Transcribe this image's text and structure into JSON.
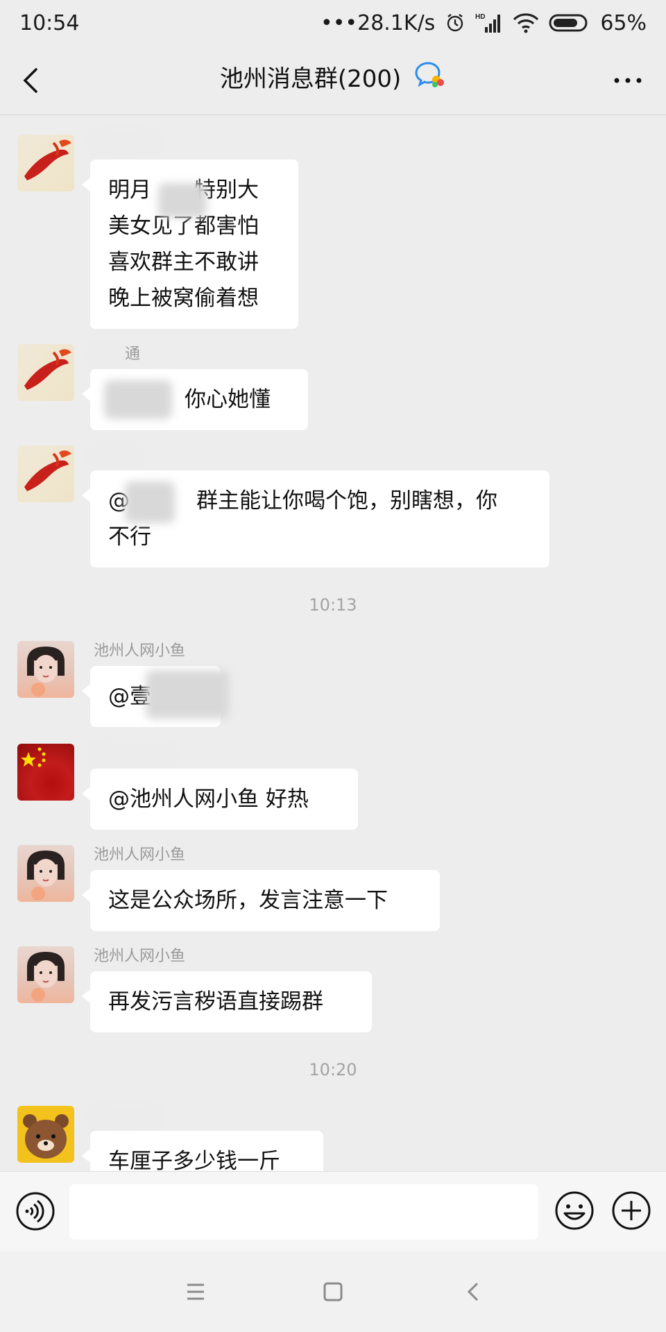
{
  "status_bar": {
    "time": "10:54",
    "network_speed": "•••28.1K/s",
    "battery": "65%",
    "hd_label": "HD"
  },
  "header": {
    "title": "池州消息群(200)"
  },
  "messages": [
    {
      "sender": "",
      "text": "明月  特别大\n美女见了都害怕\n喜欢群主不敢讲\n晚上被窝偷着想",
      "avatar": "koi-avatar"
    },
    {
      "sender": "通",
      "text": "旦  你心她懂",
      "avatar": "koi-avatar"
    },
    {
      "sender": "",
      "text": "@  群主能让你喝个饱，别瞎想，你不行",
      "avatar": "koi-avatar"
    },
    {
      "sender": "池州人网小鱼",
      "text": "@壹",
      "avatar": "girl-avatar"
    },
    {
      "sender": "",
      "text": "@池州人网小鱼  好热",
      "avatar": "flag-avatar"
    },
    {
      "sender": "池州人网小鱼",
      "text": "这是公众场所，发言注意一下",
      "avatar": "girl-avatar"
    },
    {
      "sender": "池州人网小鱼",
      "text": "再发污言秽语直接踢群",
      "avatar": "girl-avatar"
    },
    {
      "sender": "",
      "text": "车厘子多少钱一斤",
      "avatar": "bear-avatar"
    }
  ],
  "time_dividers": [
    "10:13",
    "10:20"
  ],
  "input": {
    "placeholder": "",
    "value": ""
  },
  "colors": {
    "background": "#ededed",
    "bubble": "#ffffff",
    "accent_icon": "#2b8cf0"
  }
}
